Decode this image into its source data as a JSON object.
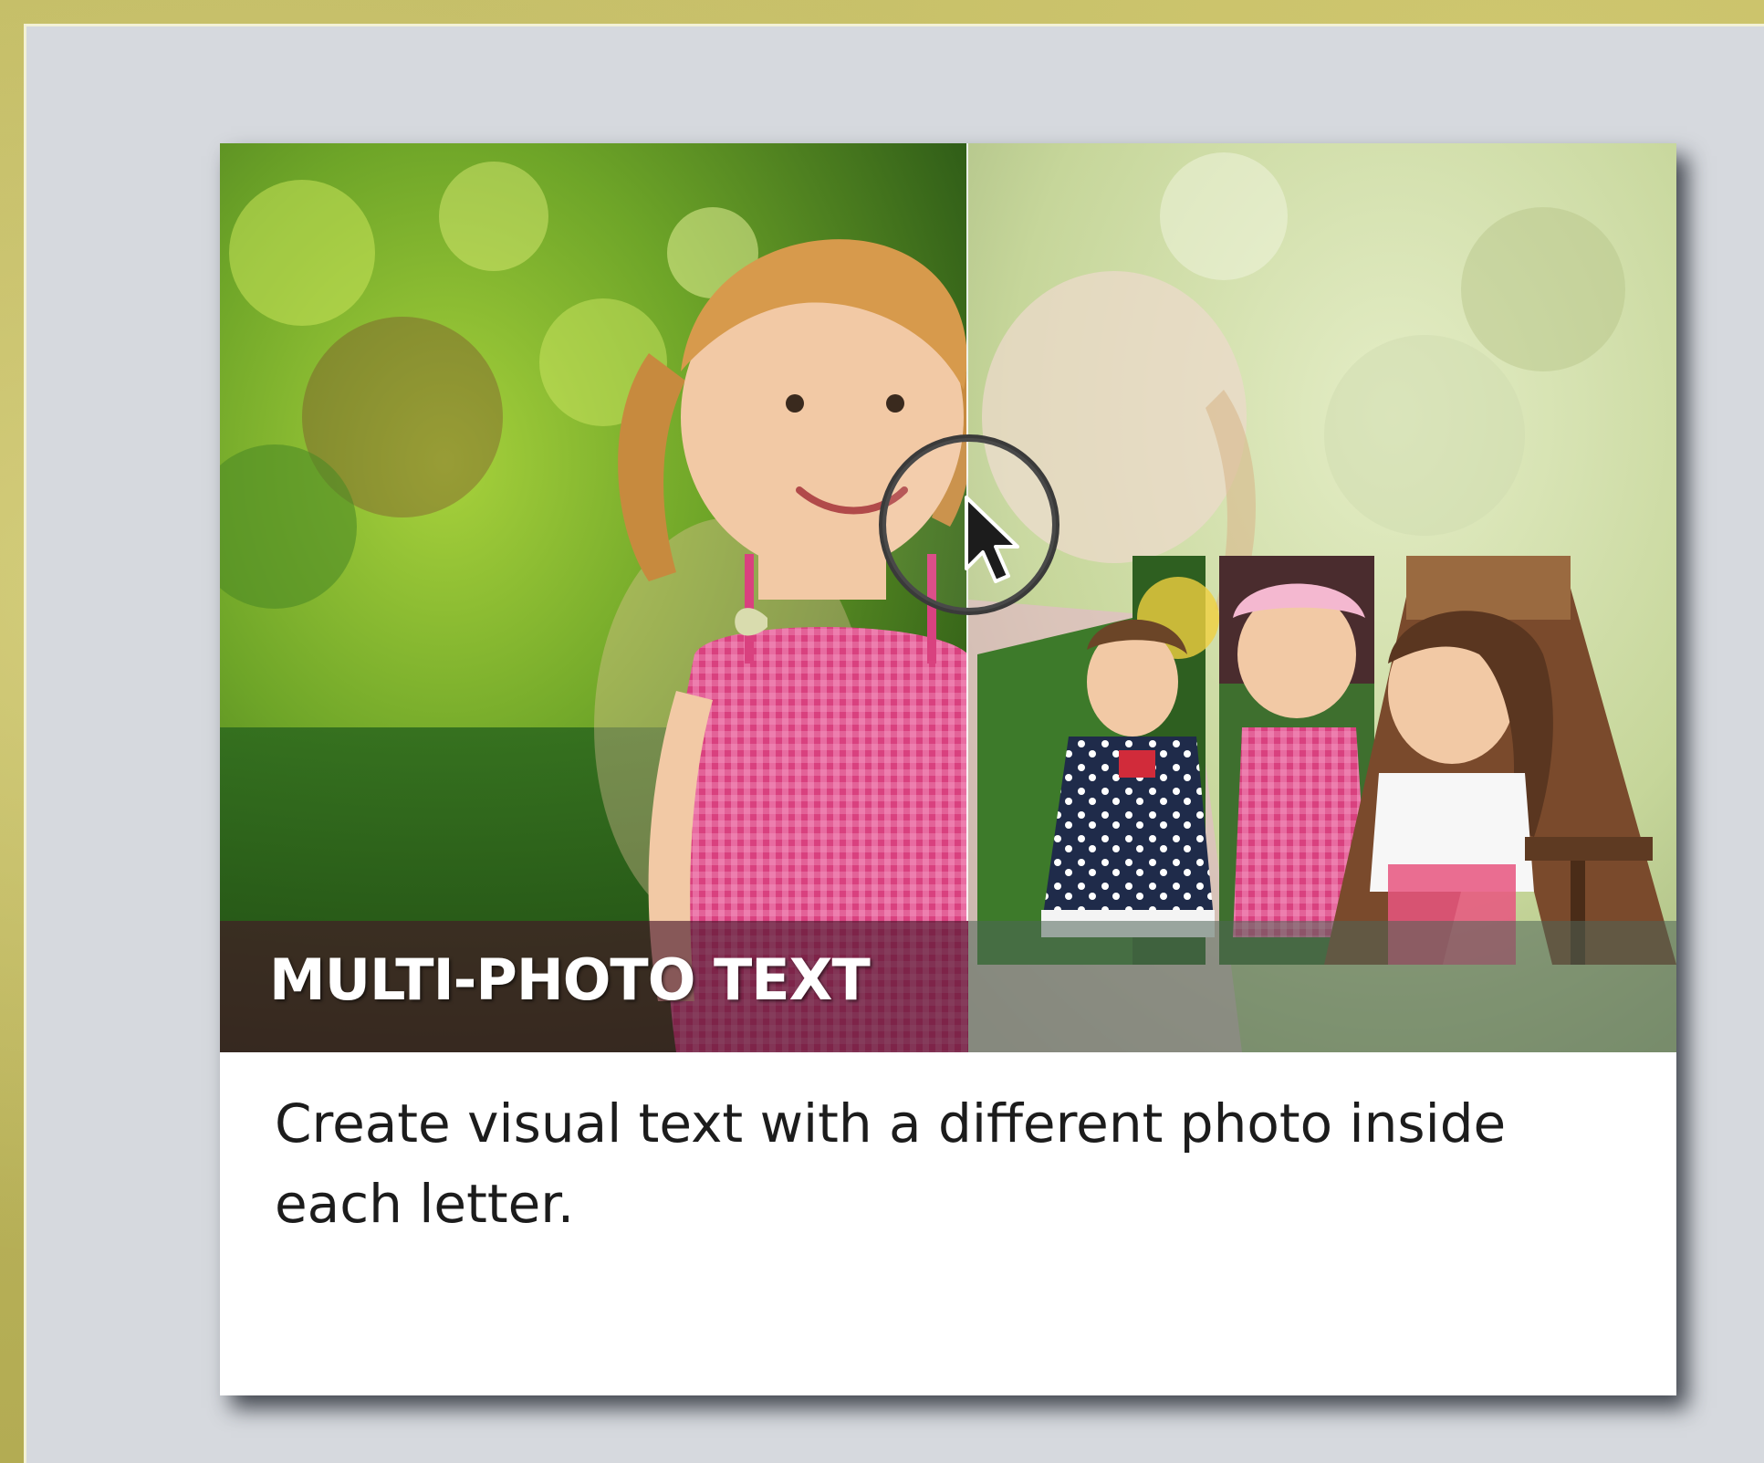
{
  "feature_card": {
    "title": "MULTI-PHOTO TEXT",
    "description": "Create visual text with a different photo inside each letter."
  },
  "preview": {
    "left_photo": "child-in-garden-photo",
    "right_photo": "multi-photo-text-letters-photo",
    "cursor": "arrow-cursor-icon",
    "drag_handle": "slider-handle-icon"
  },
  "colors": {
    "background_frame": "#b9b25a",
    "panel": "#d6d9de",
    "card": "#ffffff",
    "caption_overlay": "#46142880",
    "title_text": "#ffffff",
    "body_text": "#1c1c1c"
  }
}
